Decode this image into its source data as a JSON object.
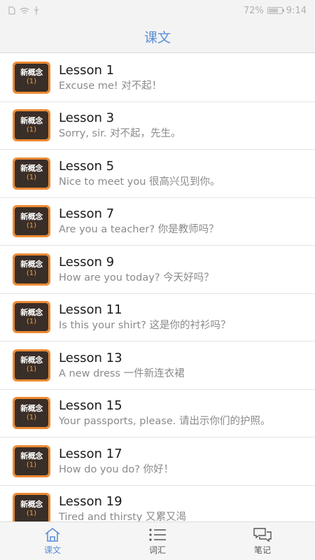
{
  "status_bar": {
    "battery_percent": "72%",
    "time": "9:14",
    "battery_level": 0.72
  },
  "header": {
    "title": "课文"
  },
  "lessons": [
    {
      "title": "Lesson 1",
      "subtitle": "Excuse me! 对不起！"
    },
    {
      "title": "Lesson 3",
      "subtitle": "Sorry, sir. 对不起，先生。"
    },
    {
      "title": "Lesson 5",
      "subtitle": "Nice to meet you 很高兴见到你。"
    },
    {
      "title": "Lesson 7",
      "subtitle": "Are you a teacher? 你是教师吗？"
    },
    {
      "title": "Lesson 9",
      "subtitle": "How are you today? 今天好吗？"
    },
    {
      "title": "Lesson 11",
      "subtitle": "Is this your shirt? 这是你的衬衫吗？"
    },
    {
      "title": "Lesson 13",
      "subtitle": "A new dress 一件新连衣裙"
    },
    {
      "title": "Lesson 15",
      "subtitle": "Your passports, please. 请出示你们的护照。"
    },
    {
      "title": "Lesson 17",
      "subtitle": "How do you do? 你好！"
    },
    {
      "title": "Lesson 19",
      "subtitle": "Tired and thirsty 又累又渴"
    }
  ],
  "book_icon": {
    "name": "新概念",
    "number": "1"
  },
  "tabs": [
    {
      "label": "课文",
      "icon": "home-icon",
      "active": true
    },
    {
      "label": "词汇",
      "icon": "list-icon",
      "active": false
    },
    {
      "label": "笔记",
      "icon": "notes-icon",
      "active": false
    }
  ],
  "colors": {
    "accent": "#5b8fd6",
    "book_orange": "#ec8a33",
    "book_dark": "#3a2e28"
  }
}
